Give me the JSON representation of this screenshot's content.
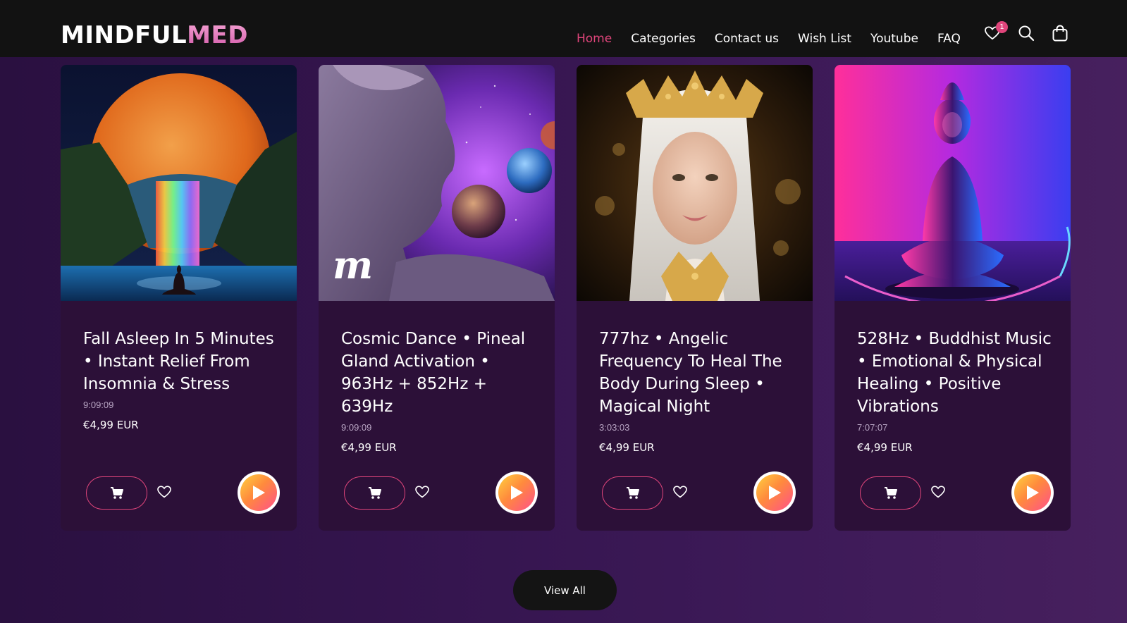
{
  "brand": {
    "logo_part1": "MINDFUL",
    "logo_part2": "MED",
    "accent": "#e0457b"
  },
  "nav": {
    "items": [
      {
        "label": "Home",
        "active": true
      },
      {
        "label": "Categories",
        "active": false
      },
      {
        "label": "Contact us",
        "active": false
      },
      {
        "label": "Wish List",
        "active": false
      },
      {
        "label": "Youtube",
        "active": false
      },
      {
        "label": "FAQ",
        "active": false
      }
    ]
  },
  "header_icons": {
    "wishlist_icon": "heart-icon",
    "wishlist_count": "1",
    "search_icon": "search-icon",
    "cart_icon": "bag-icon"
  },
  "products": [
    {
      "title": "Fall Asleep In 5 Minutes • Instant Relief From Insomnia & Stress",
      "duration": "9:09:09",
      "price": "€4,99 EUR",
      "image": "moon-waterfall-meditation"
    },
    {
      "title": "Cosmic Dance • Pineal Gland Activation • 963Hz + 852Hz + 639Hz",
      "duration": "9:09:09",
      "price": "€4,99 EUR",
      "image": "cosmic-goddess-planets",
      "watermark": "m"
    },
    {
      "title": "777hz • Angelic Frequency To Heal The Body During Sleep • Magical Night",
      "duration": "3:03:03",
      "price": "€4,99 EUR",
      "image": "elf-woman-golden-crown"
    },
    {
      "title": "528Hz • Buddhist Music • Emotional & Physical Healing • Positive Vibrations",
      "duration": "7:07:07",
      "price": "€4,99 EUR",
      "image": "neon-buddha-statue"
    }
  ],
  "view_all_label": "View All"
}
